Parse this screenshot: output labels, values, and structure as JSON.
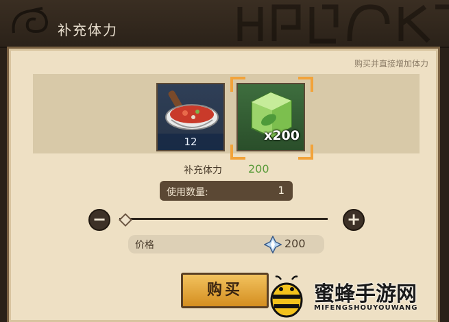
{
  "header": {
    "title": "补充体力",
    "logo_icon": "leaf-village-icon"
  },
  "panel": {
    "hint": "购买并直接增加体力"
  },
  "items": [
    {
      "name": "meat-stew",
      "icon": "stew-bowl-icon",
      "count": "12"
    },
    {
      "name": "green-cube",
      "icon": "green-cube-icon",
      "quantity": "x200",
      "selected": true
    }
  ],
  "stat": {
    "label": "补充体力",
    "value": "200"
  },
  "quantity": {
    "label": "使用数量:",
    "value": "1",
    "slider_fraction": 0.0
  },
  "price": {
    "label": "价格",
    "icon": "diamond-gem-icon",
    "value": "200"
  },
  "buy_button": {
    "label": "购买"
  },
  "watermark": {
    "title": "蜜蜂手游网",
    "subtitle": "MIFENGSHOUYOUWANG",
    "icon": "bee-icon"
  },
  "colors": {
    "accent": "#f2a33a",
    "panel": "#eee0c4",
    "stat_green": "#5a9b3a"
  }
}
